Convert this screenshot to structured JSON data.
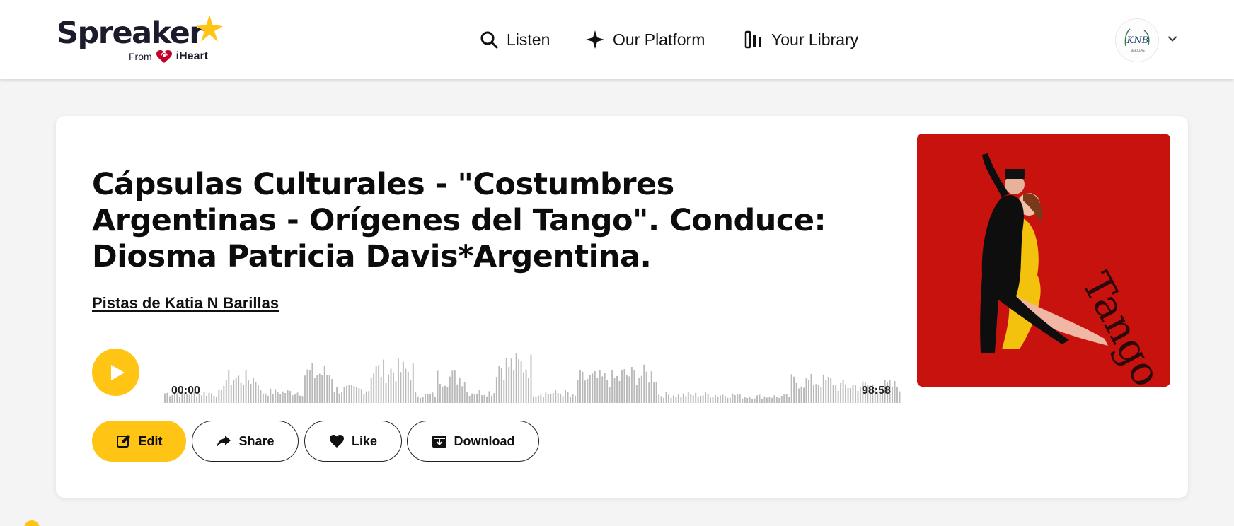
{
  "brand": {
    "name": "Spreaker",
    "from_label": "From",
    "partner": "iHeart",
    "accent_color": "#ffc414"
  },
  "nav": {
    "listen": "Listen",
    "platform": "Our Platform",
    "library": "Your Library"
  },
  "user": {
    "avatar_icon": "avatar-logo",
    "menu_icon": "chevron-down-icon"
  },
  "episode": {
    "title": "Cápsulas Culturales - \"Costumbres Argentinas - Orígenes del Tango\". Conduce: Diosma Patricia Davis*Argentina.",
    "author": "Pistas de Katia N Barillas",
    "time_start": "00:00",
    "time_end": "98:58",
    "cover_text": "Tango"
  },
  "actions": {
    "edit": "Edit",
    "share": "Share",
    "like": "Like",
    "download": "Download"
  }
}
